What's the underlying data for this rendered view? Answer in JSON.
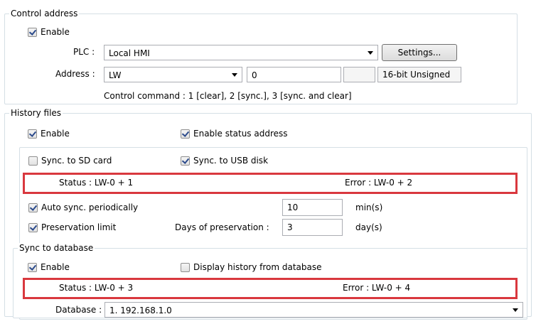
{
  "control_address": {
    "title": "Control address",
    "enable_label": "Enable",
    "enable_checked": true,
    "plc_label": "PLC :",
    "plc_value": "Local HMI",
    "settings_button": "Settings...",
    "address_label": "Address :",
    "address_device": "LW",
    "address_value": "0",
    "address_extra": "",
    "data_format": "16-bit Unsigned",
    "control_command": "Control command : 1 [clear], 2 [sync.], 3 [sync. and clear]"
  },
  "history_files": {
    "title": "History files",
    "enable_label": "Enable",
    "enable_checked": true,
    "enable_status_label": "Enable status address",
    "enable_status_checked": true,
    "sync_sd_label": "Sync. to SD card",
    "sync_sd_checked": false,
    "sync_usb_label": "Sync. to USB disk",
    "sync_usb_checked": true,
    "status_text": "Status : LW-0 + 1",
    "error_text": "Error : LW-0 + 2",
    "auto_sync_label": "Auto sync. periodically",
    "auto_sync_checked": true,
    "auto_sync_value": "10",
    "auto_sync_unit": "min(s)",
    "preservation_label": "Preservation limit",
    "preservation_checked": true,
    "days_label": "Days of preservation :",
    "days_value": "3",
    "days_unit": "day(s)"
  },
  "sync_database": {
    "title": "Sync to database",
    "enable_label": "Enable",
    "enable_checked": true,
    "display_history_label": "Display history from database",
    "display_history_checked": false,
    "status_text": "Status : LW-0 + 3",
    "error_text": "Error : LW-0 + 4",
    "database_label": "Database :",
    "database_value": "1. 192.168.1.0"
  },
  "colors": {
    "highlight_border": "#d9383e",
    "group_border": "#d5dfe5",
    "check_mark": "#2b4a8b"
  }
}
